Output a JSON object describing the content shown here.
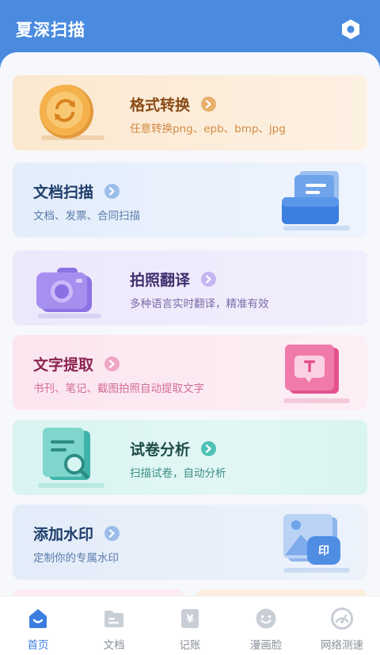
{
  "header": {
    "title": "夏深扫描"
  },
  "cards": [
    {
      "title": "格式转换",
      "desc": "任意转换png、epb、bmp、jpg",
      "icon": "format-convert-icon",
      "accent": "#e0a04a"
    },
    {
      "title": "文档扫描",
      "desc": "文档、发票、合同扫描",
      "icon": "document-scan-icon",
      "accent": "#4a86d9"
    },
    {
      "title": "拍照翻译",
      "desc": "多种语言实时翻译，精准有效",
      "icon": "camera-translate-icon",
      "accent": "#8b7be0"
    },
    {
      "title": "文字提取",
      "desc": "书刊、笔记、截图拍照自动提取文字",
      "icon": "text-extract-icon",
      "accent": "#e0609a"
    },
    {
      "title": "试卷分析",
      "desc": "扫描试卷，自动分析",
      "icon": "exam-analysis-icon",
      "accent": "#3bbcb0"
    },
    {
      "title": "添加水印",
      "desc": "定制你的专属水印",
      "icon": "watermark-icon",
      "accent": "#4a86d9"
    }
  ],
  "tabs": [
    {
      "label": "首页",
      "icon": "home-icon",
      "active": true
    },
    {
      "label": "文档",
      "icon": "folder-icon",
      "active": false
    },
    {
      "label": "记账",
      "icon": "ledger-icon",
      "active": false
    },
    {
      "label": "漫画脸",
      "icon": "smile-face-icon",
      "active": false
    },
    {
      "label": "网络测速",
      "icon": "speedometer-icon",
      "active": false
    }
  ],
  "colors": {
    "primary": "#4a8be0",
    "tab_active": "#3b7ee0",
    "tab_inactive": "#8a8f99"
  }
}
